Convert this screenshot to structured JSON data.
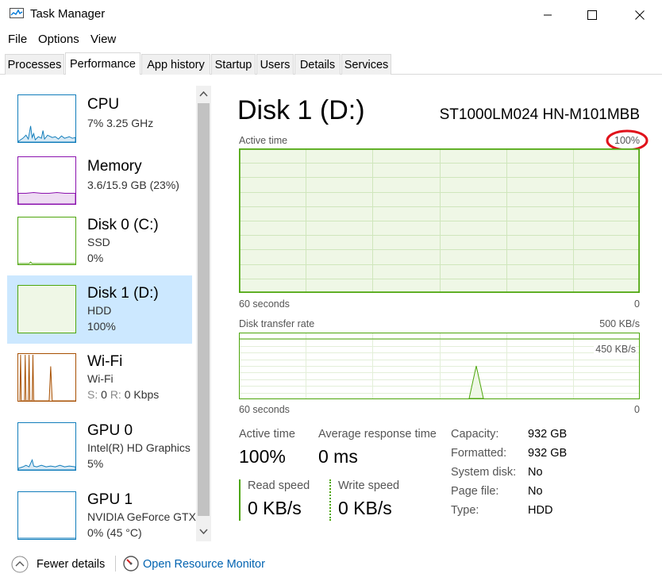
{
  "window": {
    "title": "Task Manager",
    "accent": "#0078d7"
  },
  "menu": [
    "File",
    "Options",
    "View"
  ],
  "tabs": [
    "Processes",
    "Performance",
    "App history",
    "Startup",
    "Users",
    "Details",
    "Services"
  ],
  "active_tab": "Performance",
  "sidebar": {
    "items": [
      {
        "title": "CPU",
        "line1": "7%  3.25 GHz",
        "line2": "",
        "color": "#117dbb"
      },
      {
        "title": "Memory",
        "line1": "3.6/15.9 GB (23%)",
        "line2": "",
        "color": "#8b12ae"
      },
      {
        "title": "Disk 0 (C:)",
        "line1": "SSD",
        "line2": "0%",
        "color": "#4da60c"
      },
      {
        "title": "Disk 1 (D:)",
        "line1": "HDD",
        "line2": "100%",
        "color": "#4da60c"
      },
      {
        "title": "Wi-Fi",
        "line1": "Wi-Fi",
        "line2_s": "S:",
        "line2_sv": "0",
        "line2_r": "R:",
        "line2_rv": "0 Kbps",
        "color": "#a74f01"
      },
      {
        "title": "GPU 0",
        "line1": "Intel(R) HD Graphics",
        "line2": "5%",
        "color": "#117dbb"
      },
      {
        "title": "GPU 1",
        "line1": "NVIDIA GeForce GTX",
        "line2": "0% (45 °C)",
        "color": "#117dbb"
      }
    ]
  },
  "main": {
    "title": "Disk 1 (D:)",
    "model": "ST1000LM024 HN-M101MBB",
    "graph1": {
      "label": "Active time",
      "max": "100%",
      "time_left": "60 seconds",
      "time_right": "0",
      "level_fraction": 1.0
    },
    "graph2": {
      "label": "Disk transfer rate",
      "max": "500 KB/s",
      "marker": "450 KB/s",
      "time_left": "60 seconds",
      "time_right": "0"
    },
    "stats": {
      "active_time_label": "Active time",
      "active_time_value": "100%",
      "avg_response_label": "Average response time",
      "avg_response_value": "0 ms",
      "read_label": "Read speed",
      "read_value": "0 KB/s",
      "write_label": "Write speed",
      "write_value": "0 KB/s"
    },
    "props": [
      {
        "label": "Capacity:",
        "value": "932 GB"
      },
      {
        "label": "Formatted:",
        "value": "932 GB"
      },
      {
        "label": "System disk:",
        "value": "No"
      },
      {
        "label": "Page file:",
        "value": "No"
      },
      {
        "label": "Type:",
        "value": "HDD"
      }
    ]
  },
  "footer": {
    "fewer_details": "Fewer details",
    "resource_monitor": "Open Resource Monitor"
  },
  "annotation_color": "#e0121b"
}
